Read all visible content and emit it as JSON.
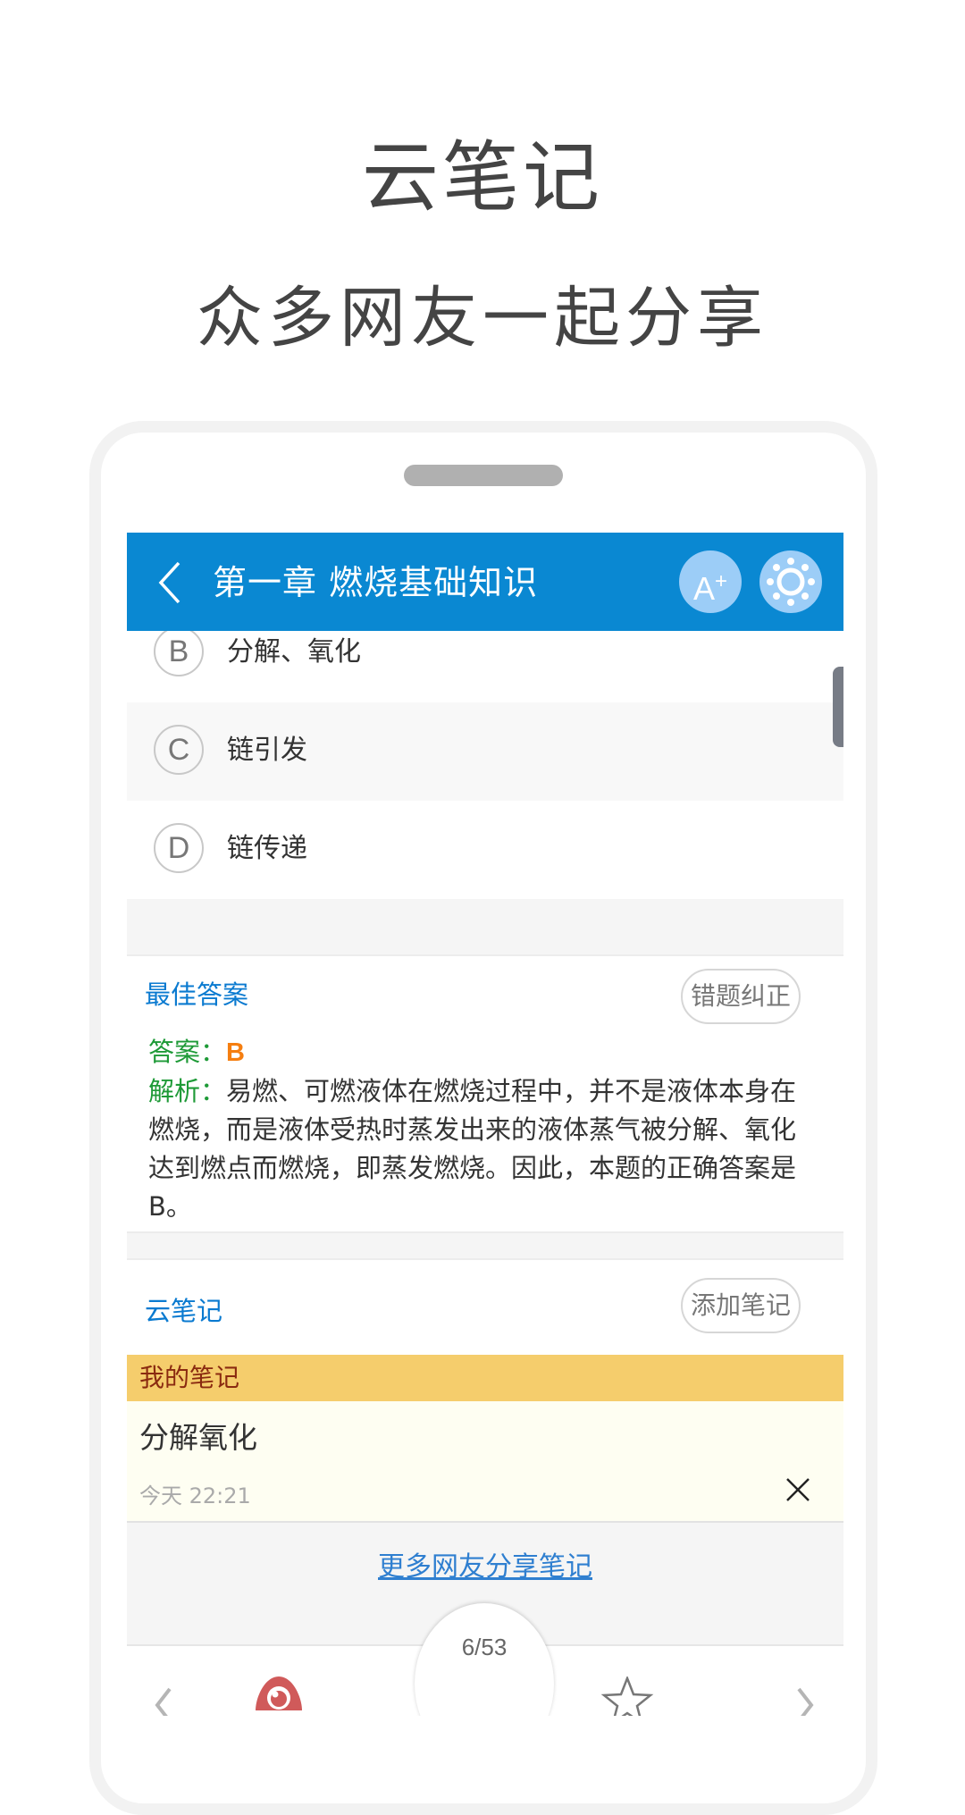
{
  "promo": {
    "title": "云笔记",
    "subtitle": "众多网友一起分享"
  },
  "header": {
    "title": "第一章 燃烧基础知识",
    "font_size_button": "A",
    "font_size_button_sup": "+",
    "icons": [
      "back-chevron-icon",
      "font-size-icon",
      "brightness-icon"
    ],
    "background_color": "#0a88d2"
  },
  "options": [
    {
      "letter": "B",
      "text": "分解、氧化"
    },
    {
      "letter": "C",
      "text": "链引发"
    },
    {
      "letter": "D",
      "text": "链传递"
    }
  ],
  "best_answer": {
    "title": "最佳答案",
    "report_button": "错题纠正",
    "answer_label": "答案：",
    "answer_value": "B",
    "analysis_label": "解析：",
    "analysis_text": "易燃、可燃液体在燃烧过程中，并不是液体本身在燃烧，而是液体受热时蒸发出来的液体蒸气被分解、氧化达到燃点而燃烧，即蒸发燃烧。因此，本题的正确答案是B。"
  },
  "cloud_notes": {
    "title": "云笔记",
    "add_button": "添加笔记",
    "my_notes_label": "我的笔记",
    "notes": [
      {
        "content": "分解氧化",
        "time": "今天 22:21"
      }
    ],
    "more_link": "更多网友分享笔记"
  },
  "bottom_bar": {
    "page_counter": "6/53",
    "current_page": 6,
    "total_pages": 53,
    "icons": [
      "prev-chevron-icon",
      "eye-icon",
      "star-icon",
      "next-chevron-icon"
    ]
  }
}
